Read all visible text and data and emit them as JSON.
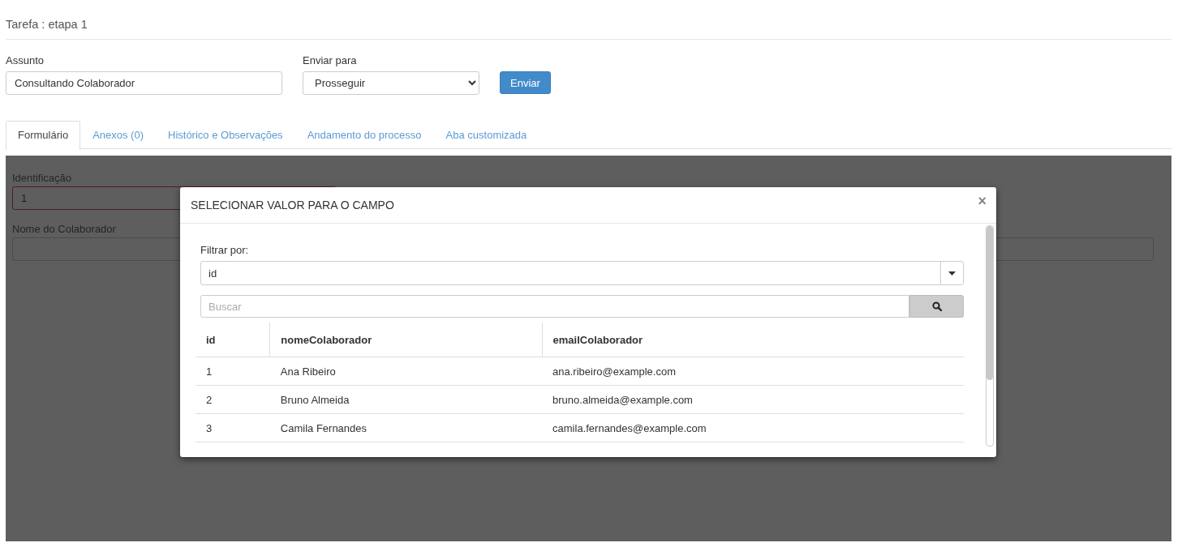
{
  "page_title": "Tarefa : etapa 1",
  "subject": {
    "label": "Assunto",
    "value": "Consultando Colaborador"
  },
  "send_to": {
    "label": "Enviar para",
    "value": "Prosseguir"
  },
  "send_button": "Enviar",
  "tabs": [
    {
      "label": "Formulário",
      "selected": true
    },
    {
      "label": "Anexos (0)",
      "selected": false
    },
    {
      "label": "Histórico e Observações",
      "selected": false
    },
    {
      "label": "Andamento do processo",
      "selected": false
    },
    {
      "label": "Aba customizada",
      "selected": false
    }
  ],
  "form_fields": [
    {
      "label": "Identificação",
      "value": "1",
      "invalid": true
    },
    {
      "label": "Nome do Colaborador",
      "invalid": false
    }
  ],
  "modal": {
    "title": "SELECIONAR VALOR PARA O CAMPO",
    "close": "×",
    "filter": {
      "label": "Filtrar por:",
      "value": "id"
    },
    "search": {
      "placeholder": "Buscar"
    },
    "table": {
      "columns": [
        "id",
        "nomeColaborador",
        "emailColaborador"
      ],
      "rows": [
        [
          "1",
          "Ana Ribeiro",
          "ana.ribeiro@example.com"
        ],
        [
          "2",
          "Bruno Almeida",
          "bruno.almeida@example.com"
        ],
        [
          "3",
          "Camila Fernandes",
          "camila.fernandes@example.com"
        ]
      ]
    }
  }
}
